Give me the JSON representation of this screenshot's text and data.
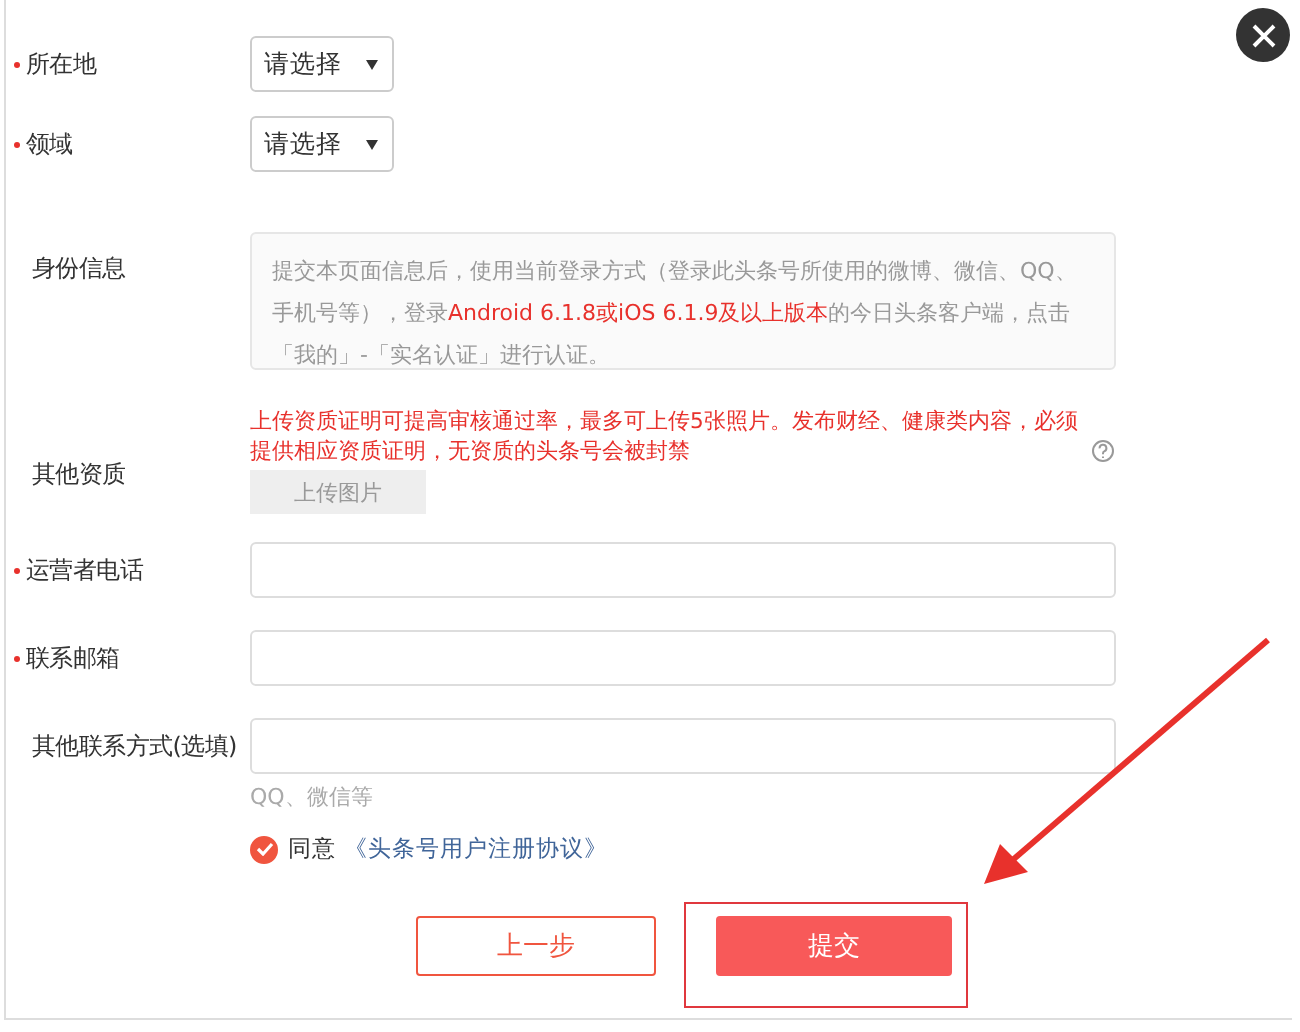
{
  "rows": [
    {
      "kind": "select",
      "label": "所在地",
      "required": true,
      "value": "请选择"
    },
    {
      "kind": "select",
      "label": "领域",
      "required": true,
      "value": "请选择"
    },
    {
      "kind": "info",
      "label": "身份信息",
      "required": false,
      "segments": [
        {
          "text": "提交本页面信息后，使用当前登录方式（登录此头条号所使用的微博、微信、QQ、手机号等），登录",
          "highlight": false
        },
        {
          "text": "Android 6.1.8或iOS 6.1.9及以上版本",
          "highlight": true
        },
        {
          "text": "的今日头条客户端，点击「我的」-「实名认证」进行认证。",
          "highlight": false
        }
      ]
    },
    {
      "kind": "upload",
      "label": "其他资质",
      "required": false,
      "note": "上传资质证明可提高审核通过率，最多可上传5张照片。发布财经、健康类内容，必须提供相应资质证明，无资质的头条号会被封禁",
      "button": "上传图片"
    },
    {
      "kind": "input",
      "label": "运营者电话",
      "required": true
    },
    {
      "kind": "input",
      "label": "联系邮箱",
      "required": true
    },
    {
      "kind": "input",
      "label": "其他联系方式(选填)",
      "required": false,
      "hint": "QQ、微信等"
    }
  ],
  "agreement": {
    "checked": true,
    "text": "同意",
    "link": "《头条号用户注册协议》"
  },
  "buttons": {
    "back": "上一步",
    "submit": "提交"
  }
}
